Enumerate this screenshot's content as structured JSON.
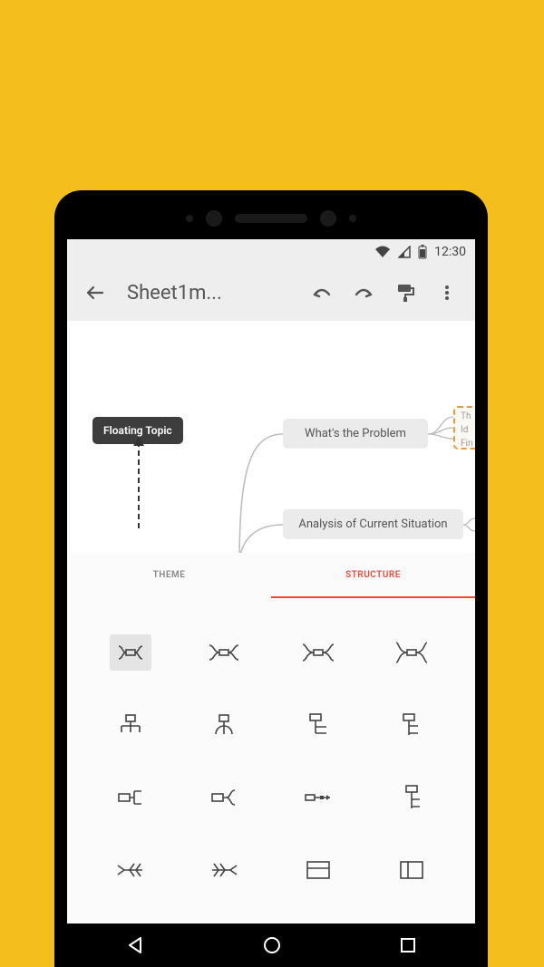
{
  "status": {
    "time": "12:30"
  },
  "appbar": {
    "title": "Sheet1m..."
  },
  "canvas": {
    "floating_topic": "Floating Topic",
    "node_problem": "What's the Problem",
    "node_analysis": "Analysis of Current Situation",
    "ghost_line1": "Th",
    "ghost_line2": "Id",
    "ghost_line3": "Fin"
  },
  "tabs": {
    "theme": "THEME",
    "structure": "STRUCTURE"
  },
  "structure_icons": [
    "mindmap-classic",
    "mindmap-spaced-1",
    "mindmap-spaced-2",
    "mindmap-spaced-3",
    "org-chart-down",
    "org-chart-branch",
    "org-chart-right",
    "org-chart-right-2",
    "logic-right",
    "logic-bracket",
    "timeline-right",
    "tree-down",
    "fishbone-left",
    "fishbone-right",
    "matrix",
    "spreadsheet-split"
  ]
}
